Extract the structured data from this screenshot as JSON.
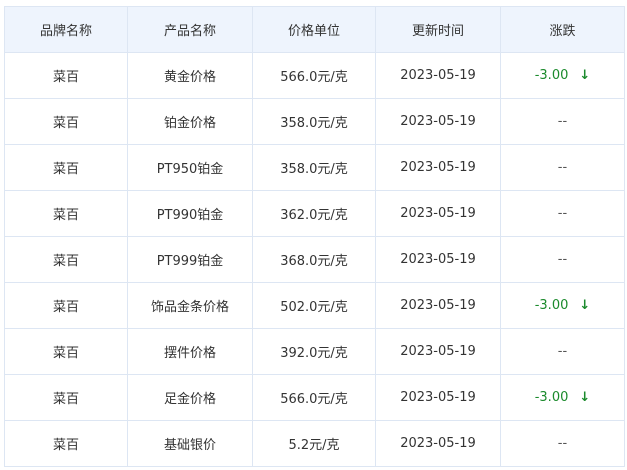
{
  "table": {
    "headers": {
      "brand": "品牌名称",
      "product": "产品名称",
      "unit_price": "价格单位",
      "updated": "更新时间",
      "change": "涨跌"
    },
    "rows": [
      {
        "brand": "菜百",
        "product": "黄金价格",
        "unit_price": "566.0元/克",
        "updated": "2023-05-19",
        "change": "-3.00",
        "direction": "down"
      },
      {
        "brand": "菜百",
        "product": "铂金价格",
        "unit_price": "358.0元/克",
        "updated": "2023-05-19",
        "change": "--",
        "direction": "flat"
      },
      {
        "brand": "菜百",
        "product": "PT950铂金",
        "unit_price": "358.0元/克",
        "updated": "2023-05-19",
        "change": "--",
        "direction": "flat"
      },
      {
        "brand": "菜百",
        "product": "PT990铂金",
        "unit_price": "362.0元/克",
        "updated": "2023-05-19",
        "change": "--",
        "direction": "flat"
      },
      {
        "brand": "菜百",
        "product": "PT999铂金",
        "unit_price": "368.0元/克",
        "updated": "2023-05-19",
        "change": "--",
        "direction": "flat"
      },
      {
        "brand": "菜百",
        "product": "饰品金条价格",
        "unit_price": "502.0元/克",
        "updated": "2023-05-19",
        "change": "-3.00",
        "direction": "down"
      },
      {
        "brand": "菜百",
        "product": "摆件价格",
        "unit_price": "392.0元/克",
        "updated": "2023-05-19",
        "change": "--",
        "direction": "flat"
      },
      {
        "brand": "菜百",
        "product": "足金价格",
        "unit_price": "566.0元/克",
        "updated": "2023-05-19",
        "change": "-3.00",
        "direction": "down"
      },
      {
        "brand": "菜百",
        "product": "基础银价",
        "unit_price": "5.2元/克",
        "updated": "2023-05-19",
        "change": "--",
        "direction": "flat"
      }
    ]
  },
  "icons": {
    "down_arrow": "down-arrow-icon",
    "down_arrow_glyph": "↓"
  },
  "colors": {
    "header_bg": "#eef4fd",
    "border": "#dde6f3",
    "down": "#1b8a2c",
    "text": "#333333"
  }
}
